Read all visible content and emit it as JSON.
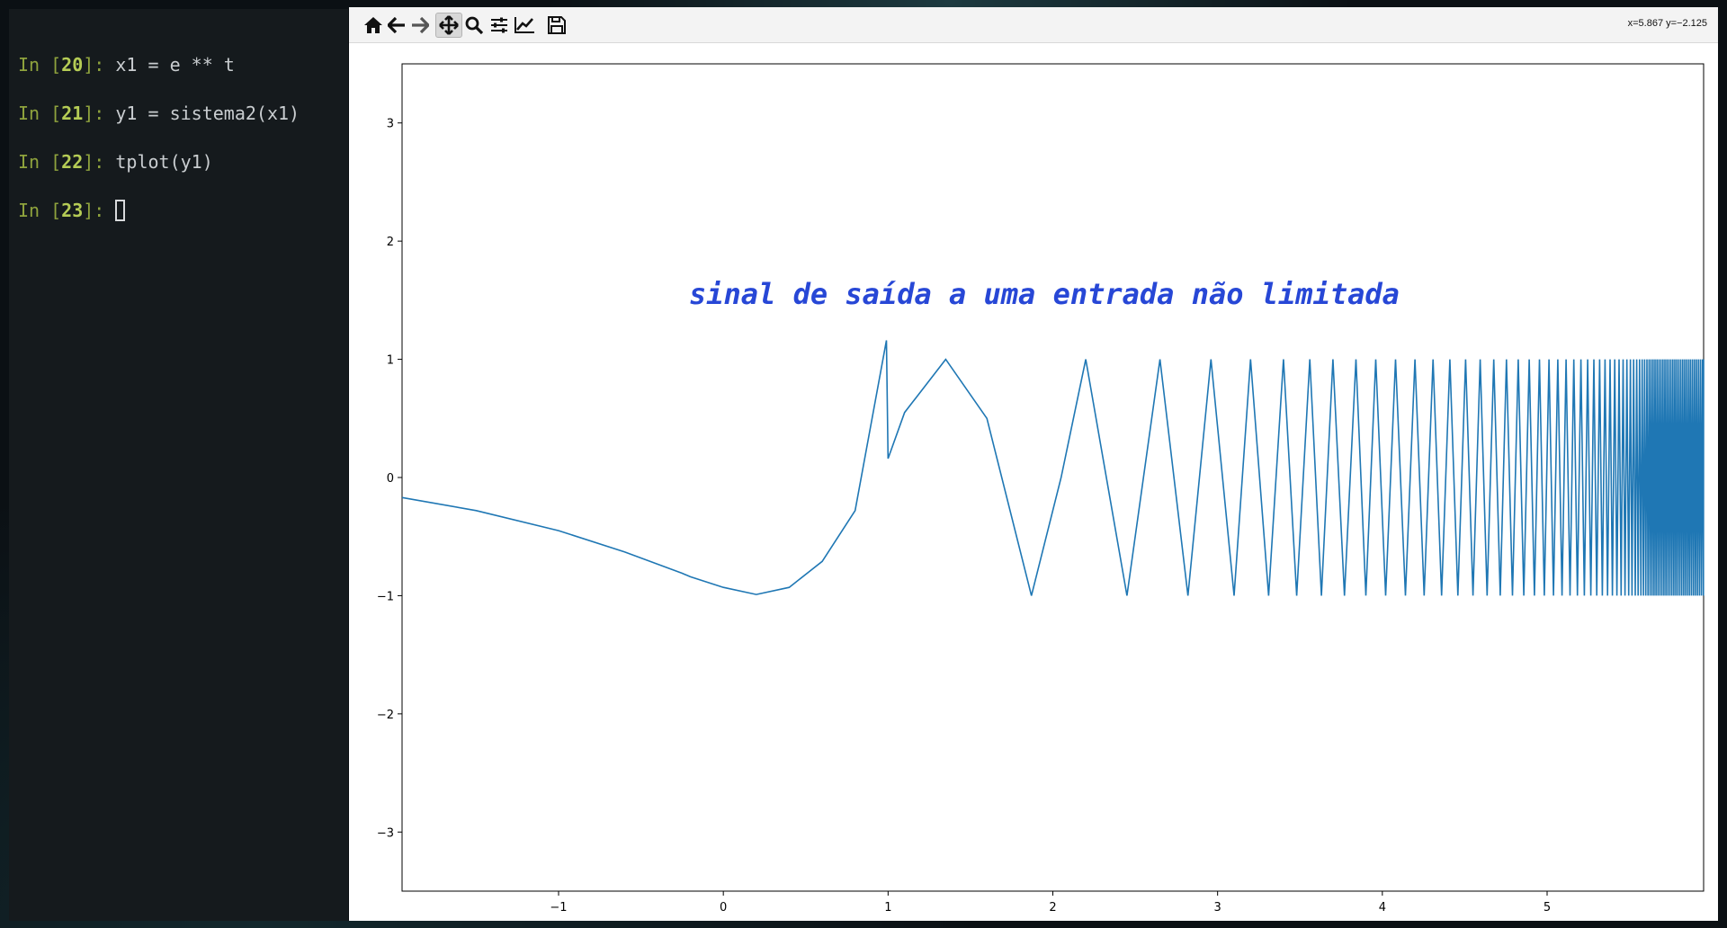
{
  "terminal": {
    "lines": [
      {
        "in": "In [",
        "num": "20",
        "close": "]: ",
        "code": "x1 = e ** t"
      },
      {
        "in": "In [",
        "num": "21",
        "close": "]: ",
        "code": "y1 = sistema2(x1)"
      },
      {
        "in": "In [",
        "num": "22",
        "close": "]: ",
        "code": "tplot(y1)"
      },
      {
        "in": "In [",
        "num": "23",
        "close": "]: ",
        "code": ""
      }
    ]
  },
  "toolbar": {
    "icons": [
      "home-icon",
      "back-arrow-icon",
      "forward-arrow-icon",
      "pan-icon",
      "zoom-icon",
      "subplots-icon",
      "edit-curve-icon",
      "save-icon"
    ],
    "active": "pan-icon",
    "coords": "x=5.867 y=−2.125"
  },
  "chart_data": {
    "type": "line",
    "title": "",
    "annotation": "sinal de saída a uma entrada não limitada",
    "xlim": [
      -1.95,
      5.95
    ],
    "ylim": [
      -3.5,
      3.5
    ],
    "xticks": [
      -1,
      0,
      1,
      2,
      3,
      4,
      5
    ],
    "yticks": [
      -3,
      -2,
      -1,
      0,
      1,
      2,
      3
    ],
    "xtick_labels": [
      "−1",
      "0",
      "1",
      "2",
      "3",
      "4",
      "5"
    ],
    "ytick_labels": [
      "−3",
      "−2",
      "−1",
      "0",
      "1",
      "2",
      "3"
    ],
    "grid": false,
    "line_color": "#1f77b4",
    "series": [
      {
        "points": [
          [
            -1.95,
            -0.17
          ],
          [
            -1.5,
            -0.28
          ],
          [
            -1.0,
            -0.45
          ],
          [
            -0.6,
            -0.63
          ],
          [
            -0.25,
            -0.81
          ],
          [
            -0.2,
            -0.84
          ],
          [
            0.0,
            -0.93
          ],
          [
            0.2,
            -0.99
          ],
          [
            0.4,
            -0.93
          ],
          [
            0.6,
            -0.71
          ],
          [
            0.8,
            -0.28
          ],
          [
            0.99,
            1.16
          ],
          [
            1.0,
            0.16
          ],
          [
            1.1,
            0.55
          ],
          [
            1.35,
            1.0
          ],
          [
            1.6,
            0.5
          ],
          [
            1.87,
            -1.0
          ],
          [
            2.05,
            0.0
          ],
          [
            2.2,
            1.0
          ],
          [
            2.45,
            -1.0
          ],
          [
            2.65,
            1.0
          ],
          [
            2.82,
            -1.0
          ],
          [
            2.96,
            1.0
          ],
          [
            3.1,
            -1.0
          ],
          [
            3.2,
            1.0
          ],
          [
            3.31,
            -1.0
          ],
          [
            3.4,
            1.0
          ],
          [
            3.48,
            -1.0
          ],
          [
            3.56,
            1.0
          ],
          [
            3.63,
            -1.0
          ],
          [
            3.7,
            1.0
          ],
          [
            3.77,
            -1.0
          ],
          [
            3.84,
            1.0
          ],
          [
            3.9,
            -1.0
          ],
          [
            3.96,
            1.0
          ],
          [
            4.02,
            -1.0
          ],
          [
            4.08,
            1.0
          ]
        ],
        "dense_oscillation": {
          "x_start": 4.08,
          "x_end": 5.95,
          "amplitude": 1.0
        }
      }
    ]
  }
}
